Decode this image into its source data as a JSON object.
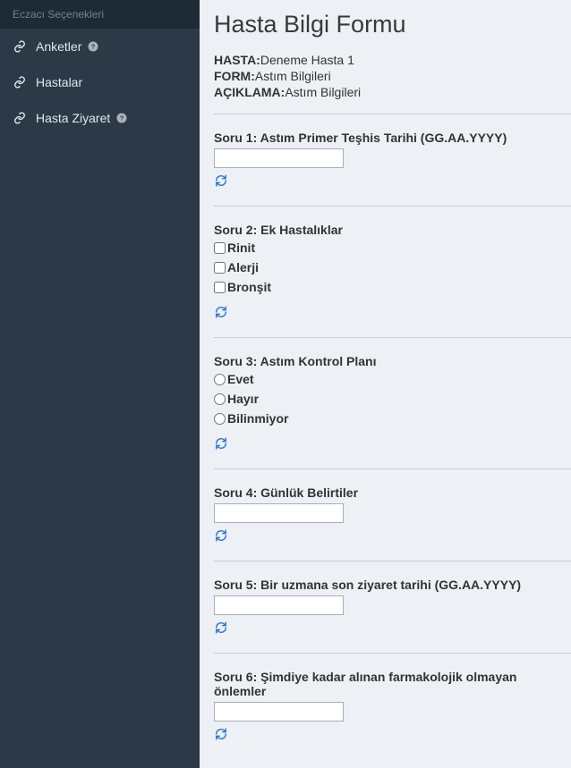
{
  "sidebar": {
    "header": "Eczacı Seçenekleri",
    "items": [
      {
        "label": "Anketler",
        "help": true
      },
      {
        "label": "Hastalar",
        "help": false
      },
      {
        "label": "Hasta Ziyaret",
        "help": true
      }
    ]
  },
  "page": {
    "title": "Hasta Bilgi Formu",
    "meta": {
      "hasta_label": "HASTA:",
      "hasta_value": "Deneme Hasta 1",
      "form_label": "FORM:",
      "form_value": "Astım Bilgileri",
      "aciklama_label": "AÇIKLAMA:",
      "aciklama_value": "Astım Bilgileri"
    }
  },
  "questions": {
    "q1": {
      "label": "Soru 1:  Astım Primer Teşhis Tarihi (GG.AA.YYYY)",
      "value": ""
    },
    "q2": {
      "label": "Soru 2:   Ek Hastalıklar",
      "options": [
        {
          "label": "Rinit"
        },
        {
          "label": "Alerji"
        },
        {
          "label": "Bronşit"
        }
      ]
    },
    "q3": {
      "label": "Soru 3:  Astım Kontrol Planı",
      "options": [
        {
          "label": "Evet"
        },
        {
          "label": "Hayır"
        },
        {
          "label": "Bilinmiyor"
        }
      ]
    },
    "q4": {
      "label": "Soru 4:  Günlük Belirtiler",
      "value": ""
    },
    "q5": {
      "label": "Soru 5:  Bir uzmana son ziyaret tarihi (GG.AA.YYYY)",
      "value": ""
    },
    "q6": {
      "label": "Soru 6:  Şimdiye kadar alınan farmakolojik olmayan önlemler",
      "value": ""
    }
  }
}
